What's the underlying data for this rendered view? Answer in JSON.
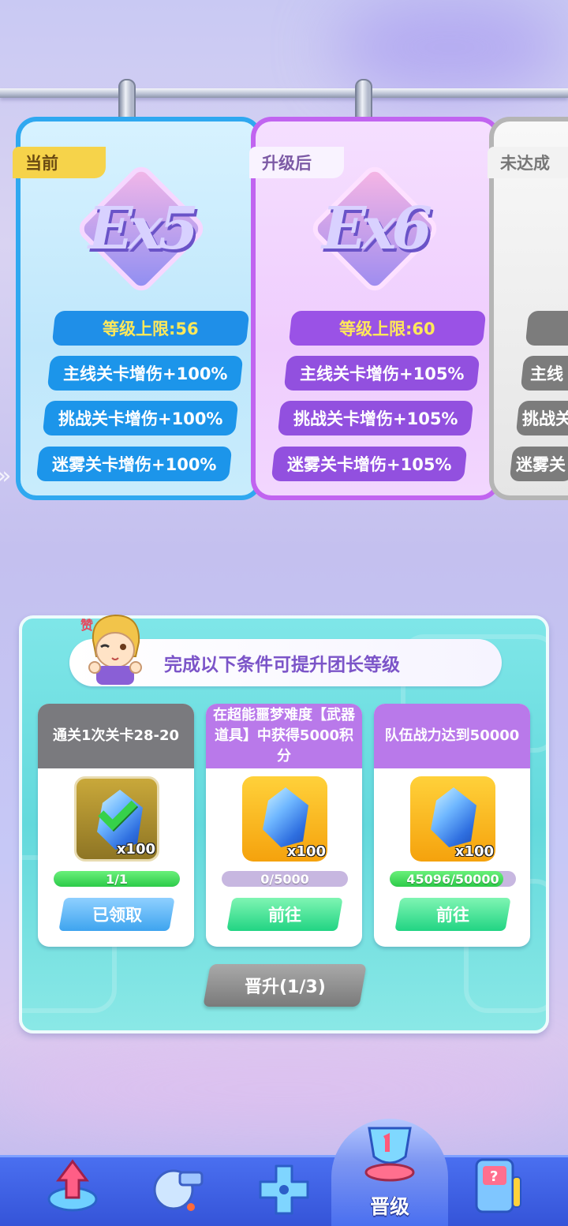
{
  "cards": [
    {
      "tag": "当前",
      "emblem": "Ex5",
      "limit": "等级上限:56",
      "bonuses": [
        "主线关卡增伤+100%",
        "挑战关卡增伤+100%",
        "迷雾关卡增伤+100%"
      ]
    },
    {
      "tag": "升级后",
      "emblem": "Ex6",
      "limit": "等级上限:60",
      "bonuses": [
        "主线关卡增伤+105%",
        "挑战关卡增伤+105%",
        "迷雾关卡增伤+105%"
      ]
    },
    {
      "tag": "未达成",
      "bonuses": [
        "主线",
        "挑战关",
        "迷雾关"
      ]
    }
  ],
  "conditions": {
    "title": "完成以下条件可提升团长等级",
    "mascot_badge": "赞",
    "tasks": [
      {
        "title": "通关1次关卡28-20",
        "reward_qty": "x100",
        "progress_text": "1/1",
        "progress": 1.0,
        "button": "已领取",
        "completed": true
      },
      {
        "title": "在超能噩梦难度【武器道具】中获得5000积分",
        "reward_qty": "x100",
        "progress_text": "0/5000",
        "progress": 0.0,
        "button": "前往",
        "completed": false
      },
      {
        "title": "队伍战力达到50000",
        "reward_qty": "x100",
        "progress_text": "45096/50000",
        "progress": 0.90192,
        "button": "前往",
        "completed": false
      }
    ],
    "promote_button": "晋升(1/3)"
  },
  "nav": {
    "items": [
      "upgrade-arrow-icon",
      "whistle-icon",
      "gamepad-icon",
      "trophy-icon",
      "arcade-machine-icon"
    ],
    "active_label": "晋级"
  },
  "colors": {
    "current": "#2fa8f0",
    "upgraded": "#c164f0",
    "locked": "#b5b5b5",
    "limit_text": "#ffe85a",
    "nav": "#4a6ff0"
  }
}
